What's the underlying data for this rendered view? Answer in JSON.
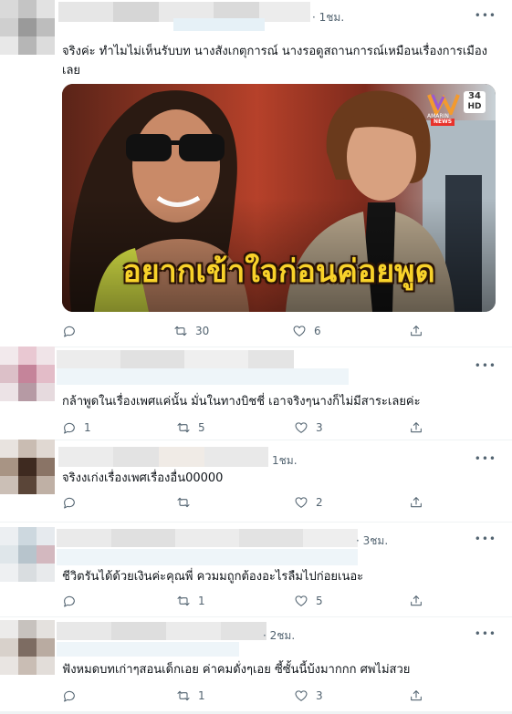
{
  "tweets": [
    {
      "time": "· 1ชม.",
      "more": "•••",
      "text_line1": "จริงค่ะ ทำไมไม่เห็นรับบท นางสังเกตุการณ์ นางรอดูสถานการณ์เหมือนเรื่องการเมือง",
      "text_line2": "เลย",
      "media": {
        "headline": "อยากเข้าใจก่อนค่อยพูด",
        "channel_number": "34",
        "channel_hd": "HD",
        "channel_news": "NEWS",
        "channel_brand": "AMARIN"
      },
      "reply_count": "",
      "retweet_count": "30",
      "like_count": "6"
    },
    {
      "time": "",
      "more": "•••",
      "text": "กล้าพูดในเรื่องเพศแค่นั้น มั่นในทางบิชชี่ เอาจริงๆนางก็ไม่มีสาระเลยค่ะ",
      "reply_count": "1",
      "retweet_count": "5",
      "like_count": "3"
    },
    {
      "time": "1ชม.",
      "more": "•••",
      "text": "จริงงเก่งเรื่องเพศเรื่องอื่น00000",
      "reply_count": "",
      "retweet_count": "",
      "like_count": "2"
    },
    {
      "time": "· 3ชม.",
      "more": "•••",
      "text": "ชีวิตรันได้ด้วยเงินค่ะคุณพี่ ควมมถูกต้องอะไรลืมไปก่อยเนอะ",
      "reply_count": "",
      "retweet_count": "1",
      "like_count": "5"
    },
    {
      "time": "· 2ชม.",
      "more": "•••",
      "text": "ฟังหมดบทเก่าๆสอนเด็กเอย ค่าคมดั่งๆเอย ซี้ซั้นนี้บ้งมากกก ศพไม่สวย",
      "reply_count": "",
      "retweet_count": "1",
      "like_count": "3"
    }
  ],
  "icons": {
    "reply": "reply-icon",
    "retweet": "retweet-icon",
    "like": "heart-icon",
    "share": "share-icon"
  },
  "colors": {
    "text": "#0f1419",
    "muted": "#536471",
    "divider": "#eff3f4",
    "headline": "#f8d22a"
  }
}
